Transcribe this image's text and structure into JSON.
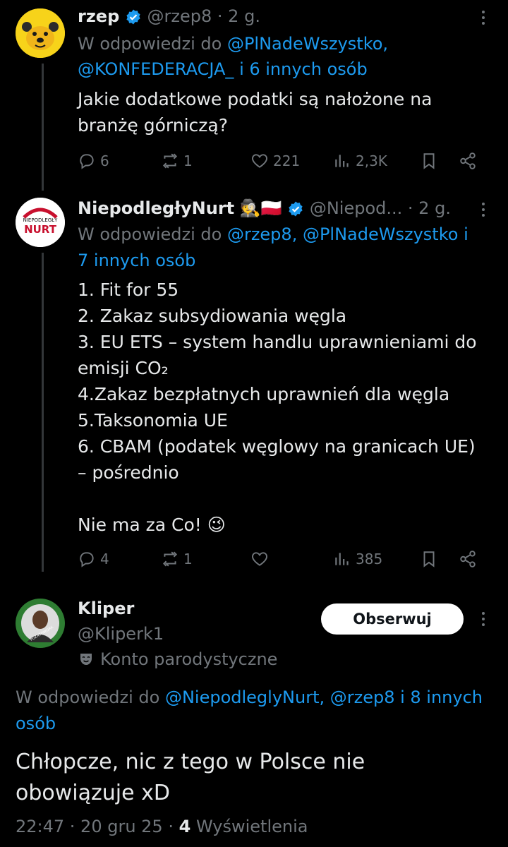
{
  "tweet1": {
    "display_name": "rzep",
    "handle": "@rzep8",
    "time": "· 2 g.",
    "reply_prefix": "W odpowiedzi do",
    "reply_to_1": "@PlNadeWszystko,",
    "reply_to_2": "@KONFEDERACJA_",
    "reply_suffix": "i 6 innych osób",
    "text_line1": "Jakie dodatkowe podatki są nałożone na",
    "text_line2": "branżę górniczą?",
    "replies": "6",
    "reposts": "1",
    "likes": "221",
    "views": "2,3K"
  },
  "tweet2": {
    "display_name": "NiepodległyNurt",
    "emojis": "🕵️🇵🇱",
    "handle": "@Niepod...",
    "time": "· 2 g.",
    "reply_prefix": "W odpowiedzi do",
    "reply_to_1": "@rzep8, @PlNadeWszystko",
    "reply_suffix_1": "i",
    "reply_suffix_2": "7 innych osób",
    "lines": [
      "1. Fit for 55",
      "2. Zakaz subsydiowania węgla",
      "3. EU ETS – system handlu uprawnieniami do",
      "emisji CO₂",
      "4.Zakaz bezpłatnych uprawnień dla węgla",
      "5.Taksonomia UE",
      "6. CBAM (podatek węglowy na granicach UE)",
      "– pośrednio"
    ],
    "closing": "Nie ma za Co! 😉",
    "replies": "4",
    "reposts": "1",
    "likes": "",
    "views": "385",
    "avatar_text_1": "NIEPODLEGŁY",
    "avatar_text_2": "NURT"
  },
  "tweet3": {
    "display_name": "Kliper",
    "handle": "@Kliperk1",
    "parody_label": "Konto parodystyczne",
    "follow_label": "Obserwuj",
    "reply_prefix": "W odpowiedzi do",
    "reply_to": "@NiepodleglyNurt, @rzep8",
    "reply_suffix_1": "i 8 innych",
    "reply_suffix_2": "osób",
    "text_line1": "Chłopcze, nic z tego w Polsce nie",
    "text_line2": "obowiązuje xD",
    "timestamp": "22:47 · 20 gru 25 ·",
    "views_count": "4",
    "views_label": "Wyświetlenia",
    "avatar_text": "POZNTOWORK"
  },
  "colors": {
    "background": "#000000",
    "text": "#e7e9ea",
    "muted": "#71767b",
    "link": "#1d9bf0",
    "verified": "#1d9bf0"
  }
}
